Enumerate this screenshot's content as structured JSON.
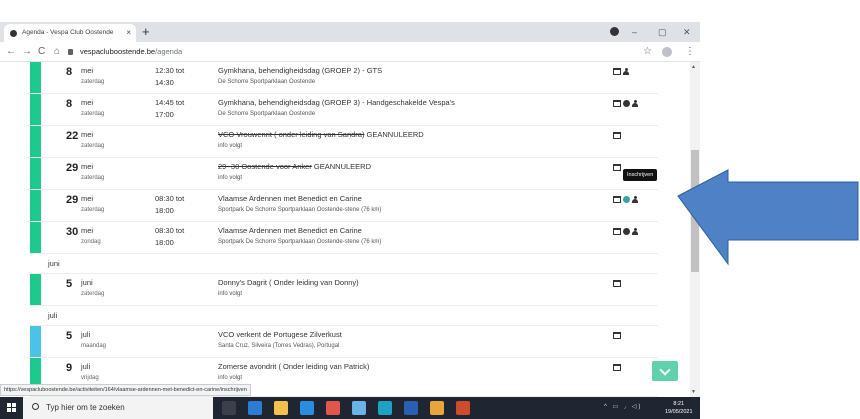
{
  "browser": {
    "tab_title": "Agenda - Vespa Club Oostende",
    "tab_close": "×",
    "new_tab": "+",
    "url_domain": "vespacluboostende.be",
    "url_path": "/agenda",
    "win_minimize": "–",
    "win_restore": "▢",
    "win_close": "✕",
    "back": "←",
    "forward": "→",
    "reload": "C",
    "home": "⌂",
    "star": "☆",
    "menu": "⋮"
  },
  "events": [
    {
      "day": "8",
      "month": "mei",
      "weekday": "zaterdag",
      "time_start": "12:30 tot",
      "time_end": "14:30",
      "title_struck": "",
      "title": "Gymkhana, behendigheidsdag (GROEP 2) - GTS",
      "location": "De Schorre Sportparklaan Oostende",
      "bar_color": "#1ec98e",
      "icons": [
        "calendar-icon",
        "user-icon"
      ]
    },
    {
      "day": "8",
      "month": "mei",
      "weekday": "zaterdag",
      "time_start": "14:45 tot",
      "time_end": "17:00",
      "title_struck": "",
      "title": "Gymkhana, behendigheidsdag (GROEP 3) - Handgeschakelde Vespa's",
      "location": "De Schorre Sportparklaan Oostende",
      "bar_color": "#1ec98e",
      "icons": [
        "calendar-icon",
        "check-circle-icon",
        "user-icon"
      ]
    },
    {
      "day": "22",
      "month": "mei",
      "weekday": "zaterdag",
      "time_start": "",
      "time_end": "",
      "title_struck": "VCO Vrouwenrit ( onder leiding van Sandra)",
      "title": " GEANNULEERD",
      "location": "info volgt",
      "bar_color": "#1ec98e",
      "icons": [
        "calendar-icon"
      ]
    },
    {
      "day": "29",
      "month": "mei",
      "weekday": "zaterdag",
      "time_start": "",
      "time_end": "",
      "title_struck": "29 -30 Oostende voor Anker",
      "title": " GEANNULEERD",
      "location": "info volgt",
      "bar_color": "#1ec98e",
      "icons": [
        "calendar-icon"
      ]
    },
    {
      "day": "29",
      "month": "mei",
      "weekday": "zaterdag",
      "time_start": "08:30 tot",
      "time_end": "18:00",
      "title_struck": "",
      "title": "Vlaamse Ardennen met Benedict en Carine",
      "location": "Sportpark De Schorre Sportparklaan Oostende-stene (76 km)",
      "bar_color": "#1ec98e",
      "icons": [
        "calendar-icon",
        "check-circle-icon",
        "user-icon"
      ]
    },
    {
      "day": "30",
      "month": "mei",
      "weekday": "zondag",
      "time_start": "08:30 tot",
      "time_end": "18:00",
      "title_struck": "",
      "title": "Vlaamse Ardennen met Benedict en Carine",
      "location": "Sportpark De Schorre Sportparklaan Oostende-stene (76 km)",
      "bar_color": "#1ec98e",
      "icons": [
        "calendar-icon",
        "check-circle-icon",
        "user-icon"
      ]
    },
    {
      "day": "5",
      "month": "juni",
      "weekday": "zaterdag",
      "time_start": "",
      "time_end": "",
      "title_struck": "",
      "title": "Donny's Dagrit ( Onder leiding van Donny)",
      "location": "info volgt",
      "bar_color": "#1ec98e",
      "icons": [
        "calendar-icon"
      ]
    },
    {
      "day": "5",
      "month": "juli",
      "weekday": "maandag",
      "time_start": "",
      "time_end": "",
      "title_struck": "",
      "title": "VCO verkent de Portugese Zilverkust",
      "location": "Santa Cruz, Silveira (Torres Vedras), Portugal",
      "bar_color": "#4cc3e6",
      "icons": [
        "calendar-icon"
      ]
    },
    {
      "day": "9",
      "month": "juli",
      "weekday": "vrijdag",
      "time_start": "",
      "time_end": "",
      "title_struck": "",
      "title": "Zomerse avondrit ( Onder leiding van Patrick)",
      "location": "info volgt",
      "bar_color": "#1ec98e",
      "icons": [
        "calendar-icon"
      ]
    }
  ],
  "month_headers": [
    "juni",
    "juli"
  ],
  "tooltip": "Inschrijven",
  "status_url": "https://vespacluboostende.be/activiteiten/164/vlaamse-ardennen-met-benedict-en-carine/inschrijven",
  "taskbar": {
    "search_placeholder": "Typ hier om te zoeken",
    "time": "8:21",
    "date": "19/05/2021"
  },
  "colors": {
    "accent": "#1ec98e",
    "accent_alt": "#4cc3e6",
    "arrow": "#4f81c7",
    "scrolltop": "#5fd1ab"
  }
}
